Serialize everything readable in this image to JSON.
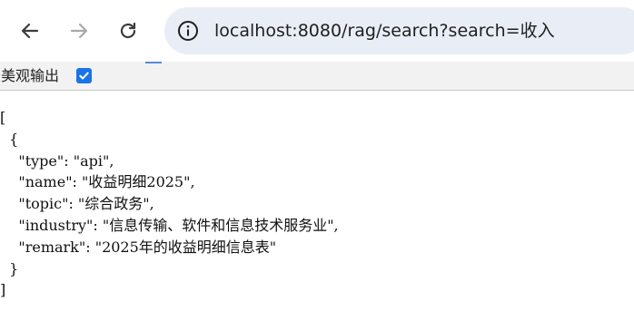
{
  "browser": {
    "url": "localhost:8080/rag/search?search=收入",
    "back_icon": "arrow-left-icon",
    "forward_icon": "arrow-right-icon",
    "reload_icon": "reload-icon",
    "site_info_icon": "info-icon"
  },
  "infobar": {
    "pretty_print_label": "美观输出",
    "pretty_print_checked": true
  },
  "json_view": {
    "lines": [
      "[",
      "  {",
      "    \"type\": \"api\",",
      "    \"name\": \"收益明细2025\",",
      "    \"topic\": \"综合政务\",",
      "    \"industry\": \"信息传输、软件和信息技术服务业\",",
      "    \"remark\": \"2025年的收益明细信息表\"",
      "  }",
      "]"
    ]
  }
}
